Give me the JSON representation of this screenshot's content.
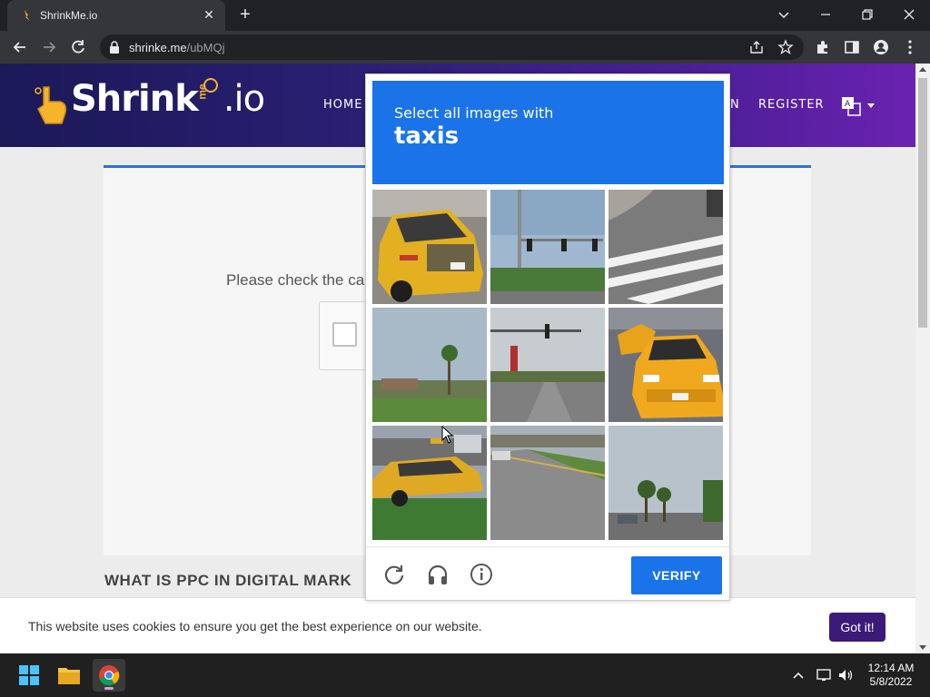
{
  "browser": {
    "tab_title": "ShrinkMe.io",
    "tab_close": "✕",
    "new_tab": "+",
    "url_domain": "shrinke.me",
    "url_path": "/ubMQj"
  },
  "site": {
    "logo_main": "Shrink",
    "logo_me": "me",
    "logo_io": ".io",
    "nav": {
      "home": "HOME",
      "login_fragment": "N",
      "register": "REGISTER"
    }
  },
  "content": {
    "check_text": "Please check the ca",
    "ppc_heading": "WHAT IS PPC IN DIGITAL MARK"
  },
  "captcha": {
    "instruction": "Select all images with",
    "target": "taxis",
    "verify_label": "VERIFY",
    "tiles": [
      {
        "scene": "taxi-closeup"
      },
      {
        "scene": "traffic-lights"
      },
      {
        "scene": "crosswalk"
      },
      {
        "scene": "palm-tree"
      },
      {
        "scene": "street-intersection"
      },
      {
        "scene": "taxi-front"
      },
      {
        "scene": "taxi-parking"
      },
      {
        "scene": "road"
      },
      {
        "scene": "palm-trees"
      }
    ],
    "footer_icons": [
      "reload-icon",
      "audio-icon",
      "info-icon"
    ]
  },
  "cookie": {
    "text": "This website uses cookies to ensure you get the best experience on our website.",
    "button": "Got it!"
  },
  "taskbar": {
    "time": "12:14 AM",
    "date": "5/8/2022"
  },
  "colors": {
    "captcha_blue": "#1a73e8",
    "header_gradient_start": "#1b1957",
    "header_gradient_end": "#6a22b0",
    "cookie_button": "#3b1a78"
  }
}
